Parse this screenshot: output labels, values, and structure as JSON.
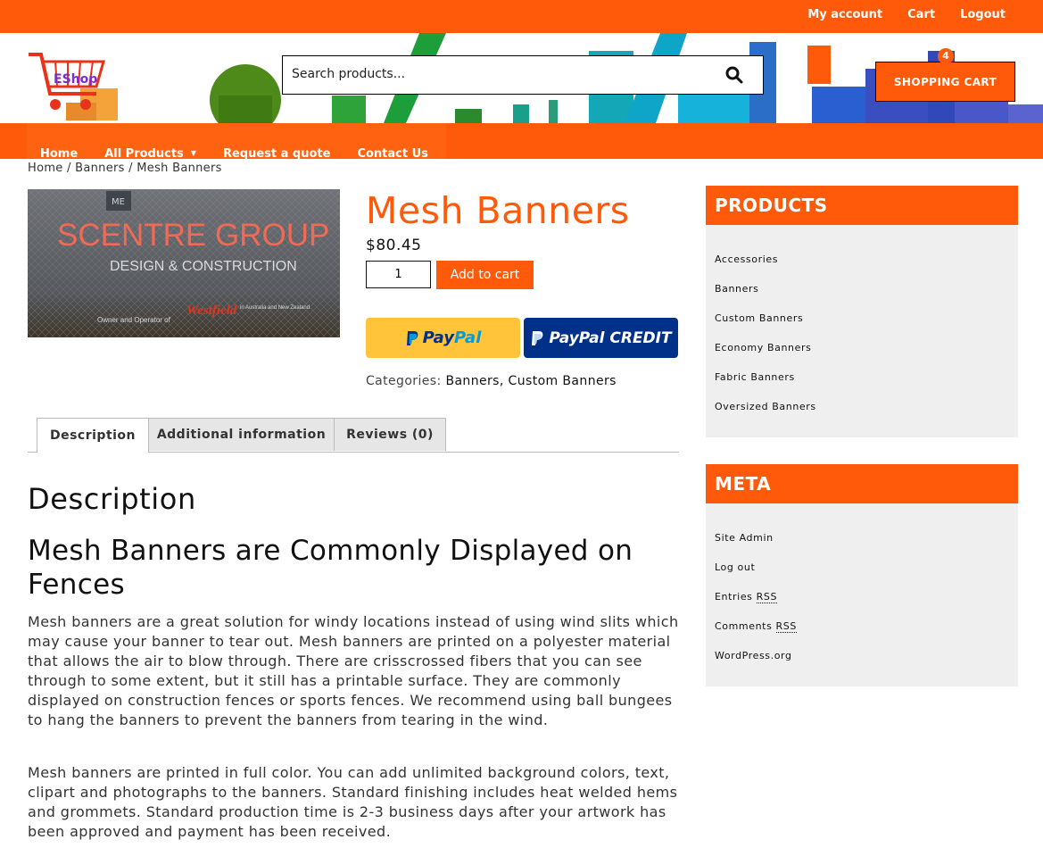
{
  "topbar": {
    "my_account": "My account",
    "cart": "Cart",
    "logout": "Logout"
  },
  "logo": {
    "text": "EShop"
  },
  "search": {
    "placeholder": "Search products..."
  },
  "cart": {
    "count": "4",
    "label": "SHOPPING CART"
  },
  "nav": {
    "items": [
      "Home",
      "All Products",
      "Request a quote",
      "Contact Us"
    ]
  },
  "breadcrumb": "Home / Banners / Mesh Banners",
  "product": {
    "title": "Mesh Banners",
    "price": "$80.45",
    "qty": "1",
    "add_to_cart": "Add to cart",
    "paypal_a": "Pay",
    "paypal_b": "Pal",
    "paypal_credit": "PayPal CREDIT",
    "categories_label": "Categories:",
    "categories_value": "Banners, Custom Banners",
    "image_text": {
      "line1": "SCENTRE GROUP",
      "line2": "DESIGN & CONSTRUCTION",
      "line3": "Owner and Operator of",
      "brand": "Westfield",
      "line4": "in Australia and New Zealand",
      "top": "ME"
    }
  },
  "tabs": [
    "Description",
    "Additional information",
    "Reviews (0)"
  ],
  "content": {
    "heading": "Description",
    "subheading": "Mesh Banners are Commonly Displayed on Fences",
    "p1": "Mesh banners are a great solution for windy locations instead of using wind slits which may cause your banner to tear out. Mesh banners are printed on a polyester material that allows the air to blow through. There are crisscrossed fibers that you can see through to some extent, but it still has a printable surface. They are commonly displayed on construction fences or sports fences. We recommend using ball bungees to hang the banners to prevent the banners from tearing in the wind.",
    "p2": "Mesh banners are printed in full color. You can add unlimited background colors, text, clipart and photographs to the banners. Standard finishing includes heat welded hems and grommets. Standard production time is 2-3 business days after your artwork has been approved and payment has been received."
  },
  "sidebar": {
    "products_title": "PRODUCTS",
    "products": [
      "Accessories",
      "Banners",
      "Custom Banners",
      "Economy Banners",
      "Fabric Banners",
      "Oversized Banners"
    ],
    "meta_title": "META",
    "meta": [
      "Site Admin",
      "Log out",
      "Entries",
      "Comments",
      "WordPress.org"
    ],
    "rss": "RSS"
  },
  "colors": {
    "accent": "#ff5a0a",
    "paypal_gold": "#ffc439",
    "paypal_blue": "#003087"
  }
}
